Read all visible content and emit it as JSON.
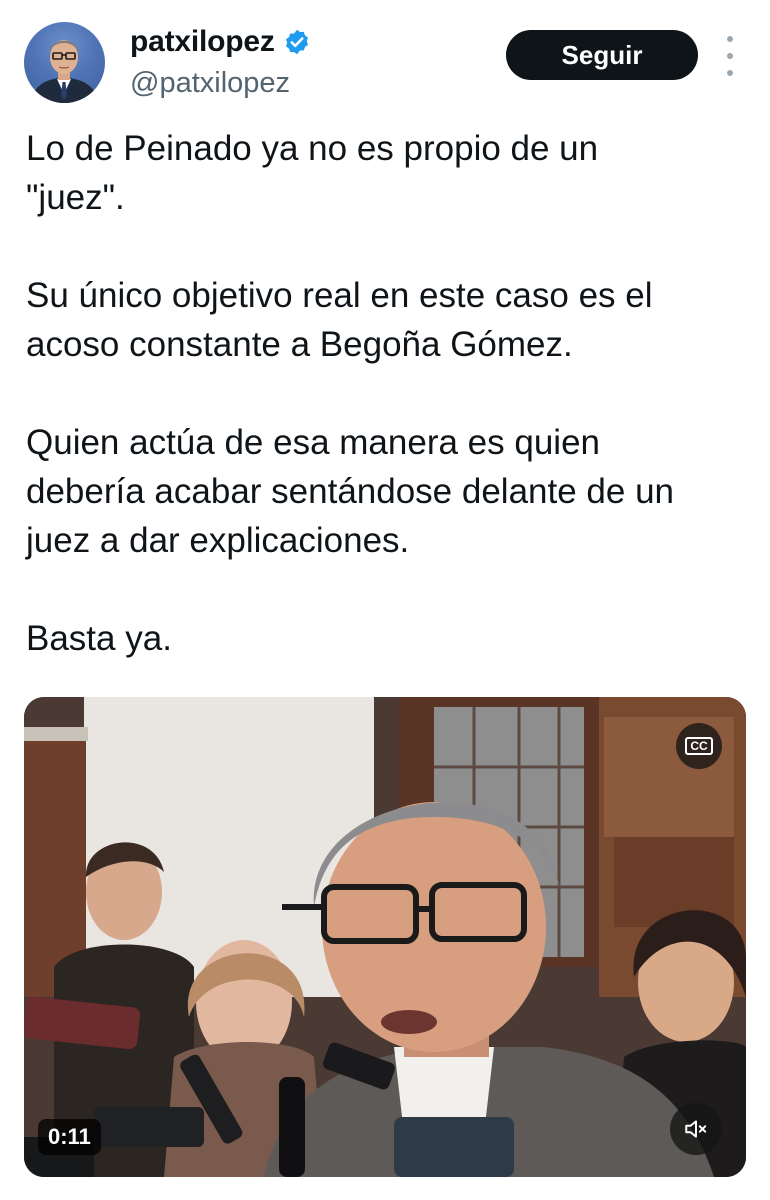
{
  "author": {
    "display_name": "patxilopez",
    "handle": "@patxilopez",
    "verified": true,
    "avatar_icon": "profile-photo"
  },
  "actions": {
    "follow_label": "Seguir",
    "more_icon": "more-vertical-icon"
  },
  "tweet": {
    "paragraphs": [
      "Lo de Peinado ya no es propio de un\n\"juez\".",
      "Su único objetivo real en este caso es el\nacoso constante a Begoña Gómez.",
      "Quien actúa de esa manera es quien\ndebería acabar sentándose delante de un\njuez a dar explicaciones.",
      "Basta ya."
    ]
  },
  "media": {
    "type": "video",
    "duration": "0:11",
    "captions_icon": "cc-icon",
    "captions_label": "CC",
    "mute_icon": "speaker-muted-icon"
  },
  "colors": {
    "text": "#0f1419",
    "secondary_text": "#536471",
    "verified_badge": "#1d9bf0",
    "follow_button_bg": "#0f1419",
    "follow_button_text": "#ffffff"
  }
}
